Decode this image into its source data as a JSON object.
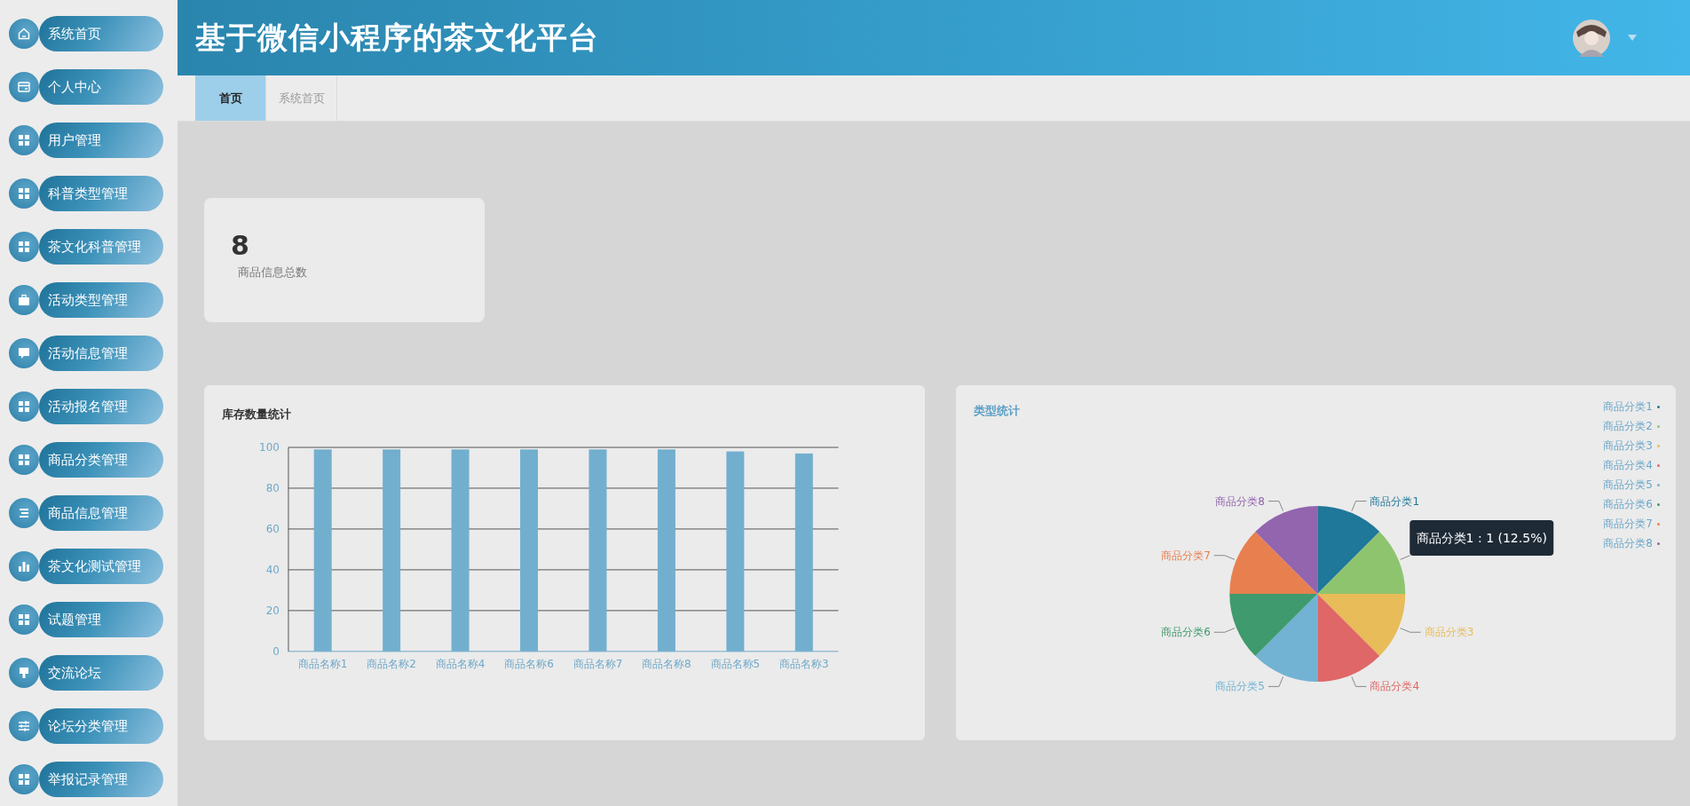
{
  "sidebar": {
    "items": [
      {
        "label": "系统首页",
        "selected": false
      },
      {
        "label": "个人中心",
        "selected": false
      },
      {
        "label": "用户管理",
        "selected": false
      },
      {
        "label": "科普类型管理",
        "selected": false
      },
      {
        "label": "茶文化科普管理",
        "selected": false
      },
      {
        "label": "活动类型管理",
        "selected": false
      },
      {
        "label": "活动信息管理",
        "selected": false
      },
      {
        "label": "活动报名管理",
        "selected": false
      },
      {
        "label": "商品分类管理",
        "selected": false
      },
      {
        "label": "商品信息管理",
        "selected": false
      },
      {
        "label": "茶文化测试管理",
        "selected": false
      },
      {
        "label": "试题管理",
        "selected": false
      },
      {
        "label": "交流论坛",
        "selected": false
      },
      {
        "label": "论坛分类管理",
        "selected": false
      },
      {
        "label": "举报记录管理",
        "selected": false
      }
    ]
  },
  "header": {
    "title": "基于微信小程序的茶文化平台"
  },
  "tabs": [
    {
      "label": "首页",
      "selected": true
    },
    {
      "label": "系统首页",
      "selected": false
    }
  ],
  "stat_card": {
    "value": "8",
    "label": "商品信息总数"
  },
  "bar_panel": {
    "chart_data": {
      "type": "bar",
      "title": "库存数量统计",
      "categories": [
        "商品名称1",
        "商品名称2",
        "商品名称4",
        "商品名称6",
        "商品名称7",
        "商品名称8",
        "商品名称5",
        "商品名称3"
      ],
      "series": [
        {
          "color": "#72afcf",
          "values": [
            99,
            99,
            99,
            99,
            99,
            99,
            98,
            97
          ]
        }
      ],
      "ylim": [
        0,
        100
      ],
      "yticks": [
        0,
        20,
        40,
        60,
        80,
        100
      ],
      "grid": true
    }
  },
  "pie_panel": {
    "chart_data": {
      "type": "pie",
      "title": "类型统计",
      "categories": [
        "商品分类1",
        "商品分类2",
        "商品分类3",
        "商品分类4",
        "商品分类5",
        "商品分类6",
        "商品分类7",
        "商品分类8"
      ],
      "series": [
        {
          "values": [
            1,
            1,
            1,
            1,
            1,
            1,
            1,
            1
          ]
        }
      ],
      "colors": [
        "#1f7799",
        "#8fc46f",
        "#e8bc58",
        "#df6767",
        "#72b3d3",
        "#3f9a6d",
        "#e87f4e",
        "#9265ae"
      ]
    },
    "slice_labels": [
      {
        "text": "商品分类1",
        "covered": false
      },
      {
        "covered": true
      },
      {
        "text": "商品分类3",
        "covered": false
      },
      {
        "text": "商品分类4",
        "covered": false
      },
      {
        "text": "商品分类5",
        "covered": false
      },
      {
        "text": "商品分类6",
        "covered": false
      },
      {
        "text": "商品分类7",
        "covered": false
      },
      {
        "text": "商品分类8",
        "covered": false
      }
    ],
    "tooltip": "商品分类1 : 1 (12.5%)"
  }
}
